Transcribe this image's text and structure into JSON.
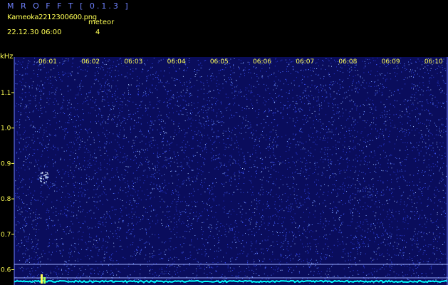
{
  "header": {
    "app_title": "M R O F F T [ 0.1.3 ]",
    "filename": "Kameoka2212300600.png",
    "timestamp": "22.12.30 06:00",
    "meteor_label": "meteor",
    "meteor_count": "4"
  },
  "axes": {
    "y_unit": "kHz",
    "time_ticks": [
      "06:01",
      "06:02",
      "06:03",
      "06:04",
      "06:05",
      "06:06",
      "06:07",
      "06:08",
      "06:09",
      "06:10"
    ],
    "freq_ticks": [
      "1.1",
      "1.0",
      "0.9",
      "0.8",
      "0.7",
      "0.6"
    ],
    "freq_values": [
      1.1,
      1.0,
      0.9,
      0.8,
      0.7,
      0.6
    ]
  },
  "colors": {
    "background": "#000000",
    "plot_background": "#0a0d5c",
    "noise": "#3a52ff",
    "label": "#ffff55",
    "title": "#6f82ff",
    "baseline": "#00ffff"
  }
}
